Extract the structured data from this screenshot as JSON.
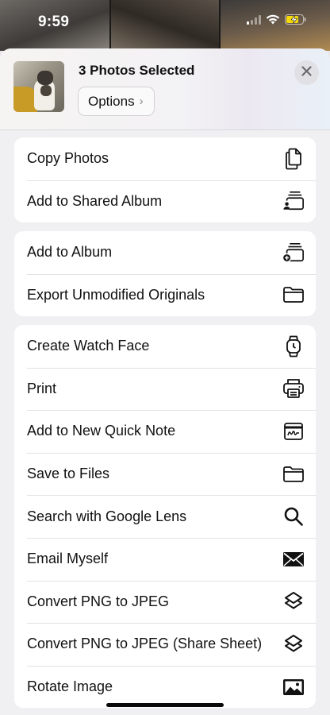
{
  "status_bar": {
    "time": "9:59"
  },
  "header": {
    "title": "3 Photos Selected",
    "options_label": "Options",
    "options_chevron": "›"
  },
  "groups": [
    {
      "rows": [
        {
          "label": "Copy Photos",
          "icon": "copy-photos-icon"
        },
        {
          "label": "Add to Shared Album",
          "icon": "shared-album-icon"
        }
      ]
    },
    {
      "rows": [
        {
          "label": "Add to Album",
          "icon": "add-album-icon"
        },
        {
          "label": "Export Unmodified Originals",
          "icon": "folder-icon"
        }
      ]
    },
    {
      "rows": [
        {
          "label": "Create Watch Face",
          "icon": "watch-icon"
        },
        {
          "label": "Print",
          "icon": "printer-icon"
        },
        {
          "label": "Add to New Quick Note",
          "icon": "quick-note-icon"
        },
        {
          "label": "Save to Files",
          "icon": "folder-icon"
        },
        {
          "label": "Search with Google Lens",
          "icon": "search-icon"
        },
        {
          "label": "Email Myself",
          "icon": "envelope-icon"
        },
        {
          "label": "Convert PNG to JPEG",
          "icon": "shortcuts-icon"
        },
        {
          "label": "Convert PNG to JPEG (Share Sheet)",
          "icon": "shortcuts-icon"
        },
        {
          "label": "Rotate Image",
          "icon": "image-icon"
        }
      ]
    }
  ],
  "colors": {
    "sheet_background": "#f0eff2",
    "row_background": "#ffffff",
    "separator": "#e2e1e5",
    "text": "#111111"
  }
}
